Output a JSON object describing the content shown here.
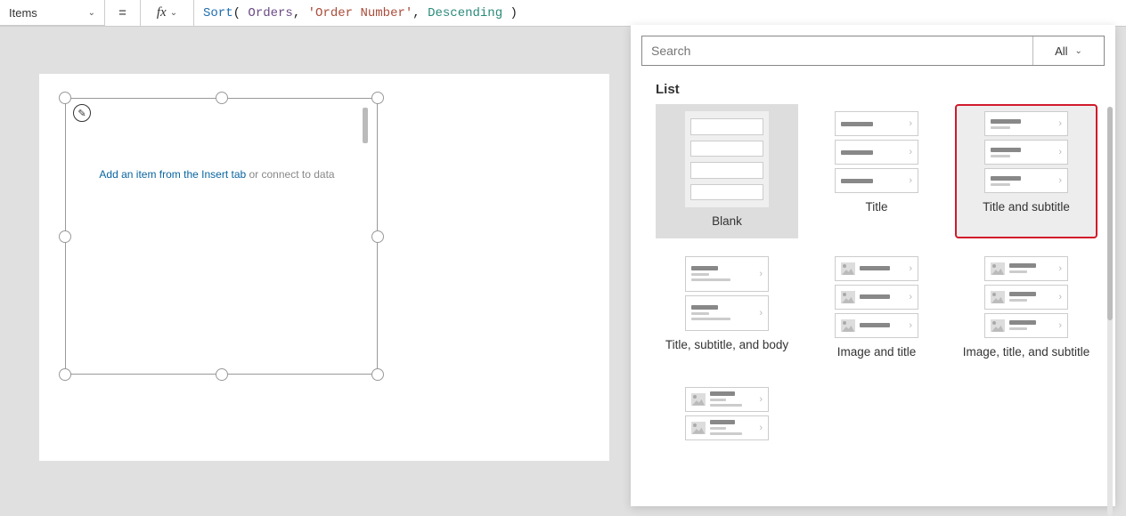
{
  "formula_bar": {
    "property": "Items",
    "fx_label": "fx",
    "formula_tokens": {
      "fn": "Sort",
      "open": "( ",
      "ds": "Orders",
      "c1": ", ",
      "str": "'Order Number'",
      "c2": ", ",
      "enum": "Descending",
      "close": " )",
      "equals": "="
    }
  },
  "canvas": {
    "empty_link": "Add an item from the Insert tab",
    "empty_plain": " or connect to data",
    "pencil": "✎"
  },
  "panel": {
    "search_placeholder": "Search",
    "filter_label": "All",
    "section": "List",
    "tiles": {
      "blank": "Blank",
      "title": "Title",
      "title_subtitle": "Title and subtitle",
      "title_subtitle_body": "Title, subtitle, and body",
      "image_title": "Image and title",
      "image_title_subtitle": "Image, title, and subtitle"
    }
  }
}
